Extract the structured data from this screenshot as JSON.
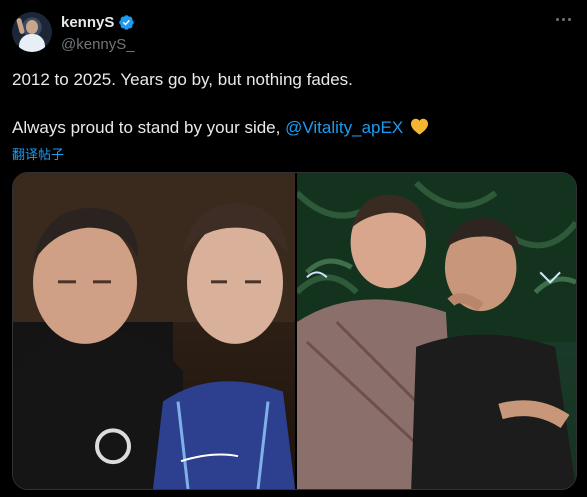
{
  "tweet": {
    "display_name": "kennyS",
    "handle": "@kennyS_",
    "line1": "2012 to 2025. Years go by, but nothing fades.",
    "line2_prefix": "Always proud to stand by your side, ",
    "mention": "@Vitality_apEX",
    "translate_label": "翻译帖子"
  },
  "icons": {
    "verified": "verified-badge-icon",
    "more": "more-options-icon",
    "heart": "yellow-heart-emoji-icon"
  },
  "colors": {
    "accent": "#1d9bf0",
    "text": "#e7e9ea",
    "secondary": "#71767b",
    "background": "#000000",
    "heart": "#f5b731"
  }
}
